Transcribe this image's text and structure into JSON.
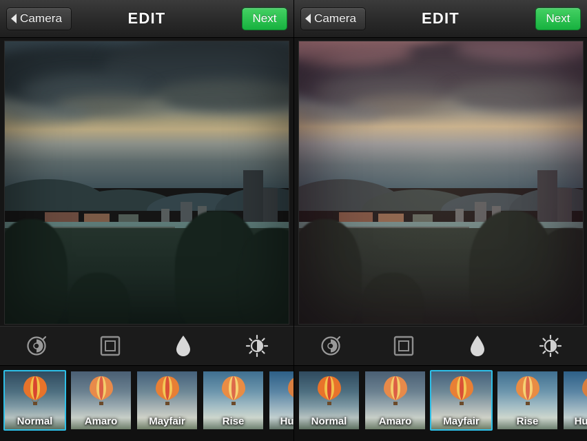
{
  "screens": [
    {
      "id": "left",
      "nav": {
        "back_label": "Camera",
        "title": "EDIT",
        "next_label": "Next"
      },
      "photo": {
        "description": "River city skyline at dusk with heavy clouds",
        "filter_applied": "Normal"
      },
      "tools": [
        {
          "name": "lux-icon",
          "label": "Lux"
        },
        {
          "name": "frame-icon",
          "label": "Frame"
        },
        {
          "name": "blur-drop-icon",
          "label": "Tilt-shift"
        },
        {
          "name": "brightness-icon",
          "label": "Brightness"
        }
      ],
      "filters": [
        {
          "label": "Normal",
          "selected": true
        },
        {
          "label": "Amaro",
          "selected": false
        },
        {
          "label": "Mayfair",
          "selected": false
        },
        {
          "label": "Rise",
          "selected": false
        },
        {
          "label": "Hudson",
          "selected": false
        }
      ]
    },
    {
      "id": "right",
      "nav": {
        "back_label": "Camera",
        "title": "EDIT",
        "next_label": "Next"
      },
      "photo": {
        "description": "Same river city skyline with warm pink Mayfair tone",
        "filter_applied": "Mayfair"
      },
      "tools": [
        {
          "name": "lux-icon",
          "label": "Lux"
        },
        {
          "name": "frame-icon",
          "label": "Frame"
        },
        {
          "name": "blur-drop-icon",
          "label": "Tilt-shift"
        },
        {
          "name": "brightness-icon",
          "label": "Brightness"
        }
      ],
      "filters": [
        {
          "label": "Normal",
          "selected": false
        },
        {
          "label": "Amaro",
          "selected": false
        },
        {
          "label": "Mayfair",
          "selected": true
        },
        {
          "label": "Rise",
          "selected": false
        },
        {
          "label": "Hudson",
          "selected": false
        }
      ]
    }
  ],
  "colors": {
    "selection_outline": "#2ec0e8",
    "next_button": "#1fbf4a",
    "nav_bar": "#2b2b2b",
    "background": "#000000"
  }
}
